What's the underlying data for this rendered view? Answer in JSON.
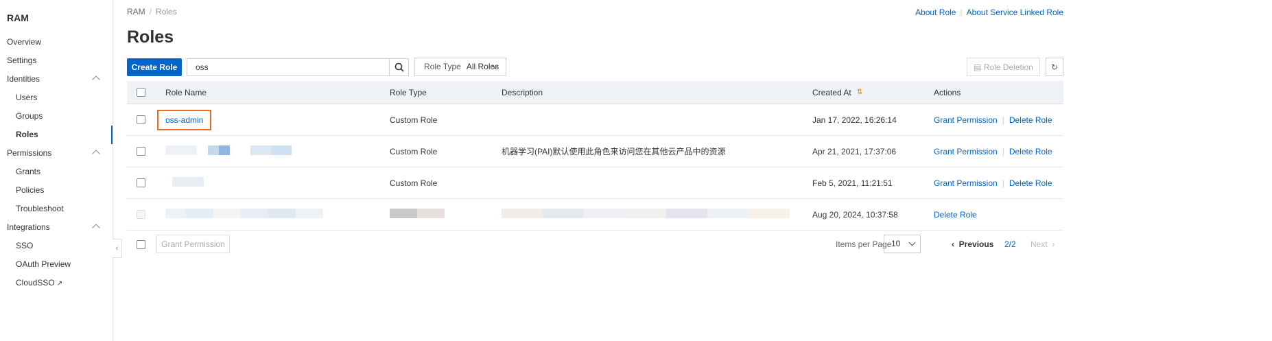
{
  "sidebar": {
    "title": "RAM",
    "items": [
      {
        "label": "Overview",
        "sub": false
      },
      {
        "label": "Settings",
        "sub": false
      },
      {
        "label": "Identities",
        "sub": false,
        "expanded": true
      },
      {
        "label": "Users",
        "sub": true
      },
      {
        "label": "Groups",
        "sub": true
      },
      {
        "label": "Roles",
        "sub": true,
        "active": true
      },
      {
        "label": "Permissions",
        "sub": false,
        "expanded": true
      },
      {
        "label": "Grants",
        "sub": true
      },
      {
        "label": "Policies",
        "sub": true
      },
      {
        "label": "Troubleshoot",
        "sub": true
      },
      {
        "label": "Integrations",
        "sub": false,
        "expanded": true
      },
      {
        "label": "SSO",
        "sub": true
      },
      {
        "label": "OAuth Preview",
        "sub": true
      },
      {
        "label": "CloudSSO",
        "sub": true,
        "external": true
      }
    ]
  },
  "breadcrumb": {
    "root": "RAM",
    "sep": "/",
    "current": "Roles"
  },
  "top_links": {
    "about_role": "About Role",
    "about_slr": "About Service Linked Role"
  },
  "page_title": "Roles",
  "toolbar": {
    "create_label": "Create Role",
    "search_value": "oss",
    "role_type_label": "Role Type",
    "role_type_value": "All Roles",
    "role_deletion_label": "Role Deletion"
  },
  "table": {
    "headers": {
      "name": "Role Name",
      "type": "Role Type",
      "description": "Description",
      "created": "Created At",
      "actions": "Actions"
    },
    "rows": [
      {
        "name": "oss-admin",
        "type": "Custom Role",
        "description": "",
        "created": "Jan 17, 2022, 16:26:14",
        "grant": "Grant Permission",
        "delete": "Delete Role"
      },
      {
        "name": "",
        "type": "Custom Role",
        "description": "机器学习(PAI)默认使用此角色来访问您在其他云产品中的资源",
        "created": "Apr 21, 2021, 17:37:06",
        "grant": "Grant Permission",
        "delete": "Delete Role"
      },
      {
        "name": "",
        "type": "Custom Role",
        "description": "",
        "created": "Feb 5, 2021, 11:21:51",
        "grant": "Grant Permission",
        "delete": "Delete Role"
      },
      {
        "name": "",
        "type": "",
        "description": "",
        "created": "Aug 20, 2024, 10:37:58",
        "grant": "",
        "delete": "Delete Role"
      }
    ]
  },
  "footer": {
    "grant_label": "Grant Permission",
    "items_per_page_label": "Items per Page",
    "items_per_page": "10",
    "prev": "Previous",
    "page": "2/2",
    "next": "Next"
  }
}
